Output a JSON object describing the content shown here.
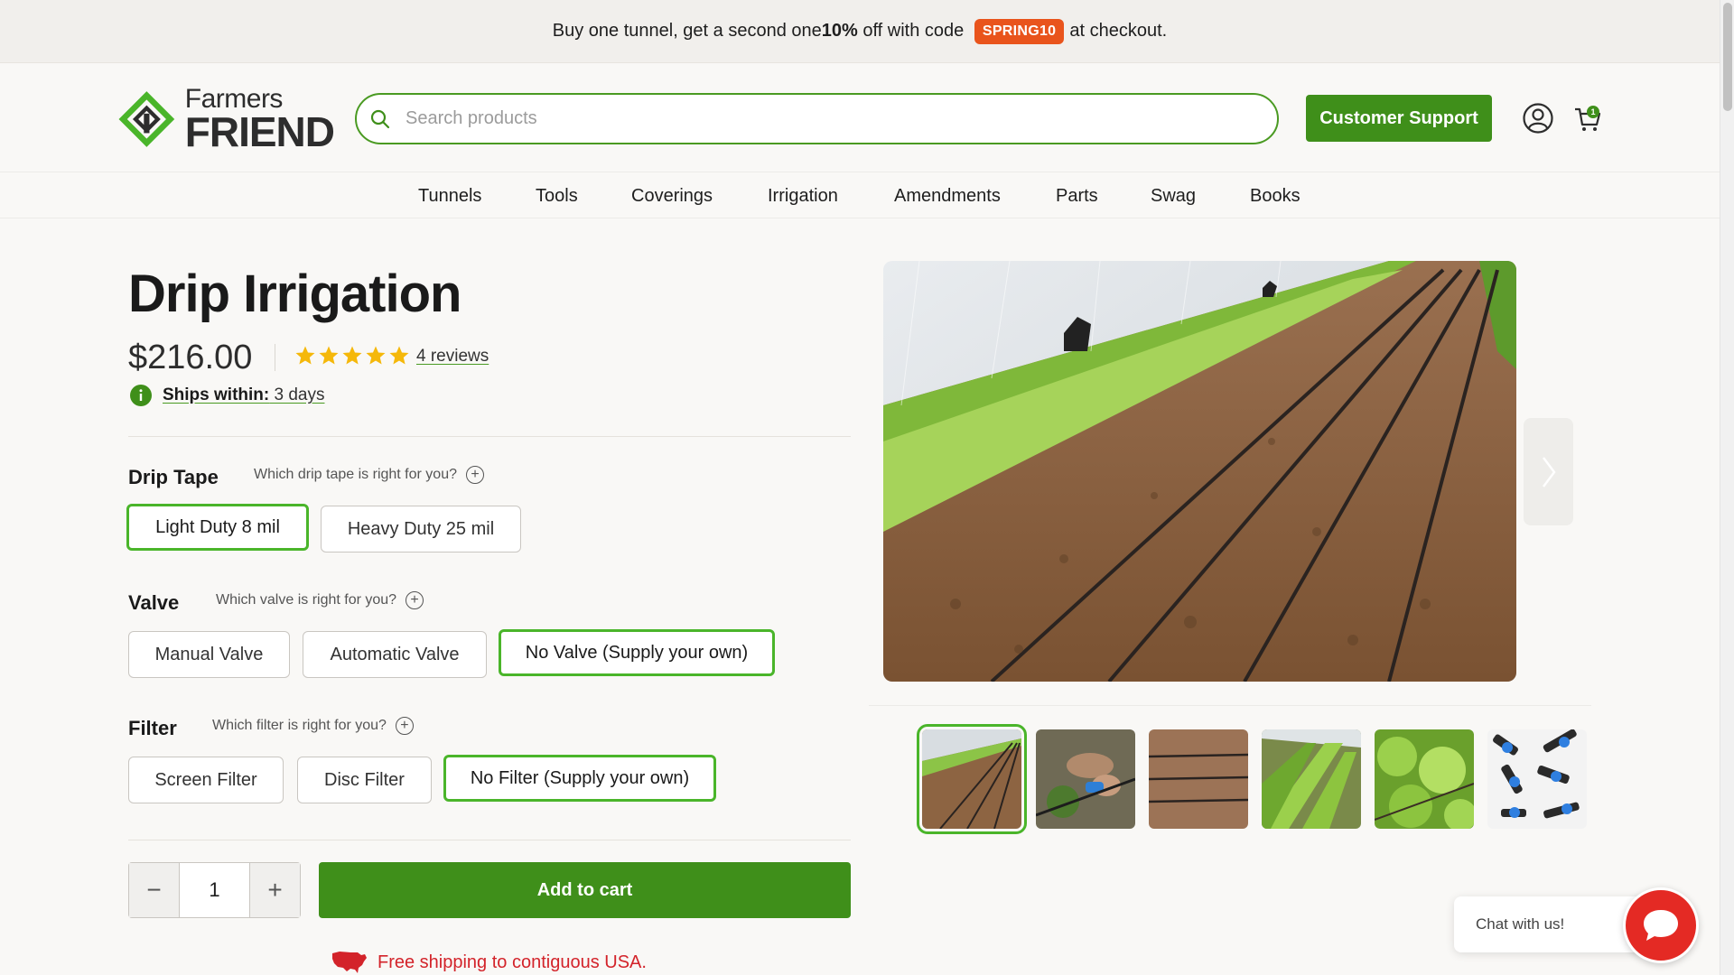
{
  "promo": {
    "before": "Buy one tunnel, get a second one ",
    "discount": "10%",
    "middle": " off with code ",
    "code": "SPRING10",
    "after": " at checkout."
  },
  "header": {
    "logo_line1": "Farmers",
    "logo_line2": "FRIEND",
    "search_placeholder": "Search products",
    "support_label": "Customer Support",
    "cart_count": "1"
  },
  "nav": [
    {
      "label": "Tunnels"
    },
    {
      "label": "Tools"
    },
    {
      "label": "Coverings"
    },
    {
      "label": "Irrigation"
    },
    {
      "label": "Amendments"
    },
    {
      "label": "Parts"
    },
    {
      "label": "Swag"
    },
    {
      "label": "Books"
    }
  ],
  "product": {
    "title": "Drip Irrigation",
    "price": "$216.00",
    "rating": 5,
    "reviews_label": "4 reviews",
    "ships_label": "Ships within:",
    "ships_value": " 3 days"
  },
  "options": {
    "drip_tape": {
      "label": "Drip Tape",
      "help": "Which drip tape is right for you?",
      "choices": [
        "Light Duty 8 mil",
        "Heavy Duty 25 mil"
      ],
      "selected": "Light Duty 8 mil"
    },
    "valve": {
      "label": "Valve",
      "help": "Which valve is right for you?",
      "choices": [
        "Manual Valve",
        "Automatic Valve",
        "No Valve (Supply your own)"
      ],
      "selected": "No Valve (Supply your own)"
    },
    "filter": {
      "label": "Filter",
      "help": "Which filter is right for you?",
      "choices": [
        "Screen Filter",
        "Disc Filter",
        "No Filter (Supply your own)"
      ],
      "selected": "No Filter (Supply your own)"
    }
  },
  "purchase": {
    "quantity": "1",
    "minus": "−",
    "plus": "+",
    "add_to_cart": "Add to cart",
    "shipping_note": "Free shipping to contiguous USA."
  },
  "chat": {
    "label": "Chat with us!"
  },
  "colors": {
    "brand_green": "#3f8f1a",
    "selected_outline": "#4ab52a",
    "promo_code_bg": "#e9541c",
    "shipping_red": "#d3232a",
    "chat_red": "#e42a24"
  }
}
